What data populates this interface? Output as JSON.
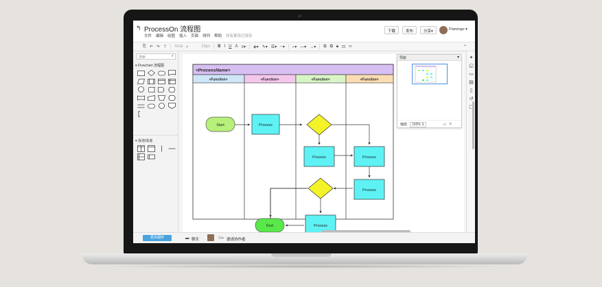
{
  "app": {
    "title": "ProcessOn 流程图",
    "menus": [
      "文件",
      "编辑",
      "绘图",
      "插入",
      "页面",
      "排列",
      "帮助"
    ],
    "save_status": "所有更改已保存",
    "buttons": {
      "download": "下载",
      "publish": "发布",
      "share": "分享▾"
    },
    "user": "Flamingo ▾"
  },
  "toolbar": {
    "font": "Arial",
    "font_size": "16px",
    "bold": "B",
    "italic": "I",
    "underline": "U",
    "text_a": "A"
  },
  "sidebar": {
    "search_placeholder": "搜索",
    "section1": "Flowchart 流程图",
    "section2": "泳池/泳道",
    "more_button": "更多图形"
  },
  "navigator": {
    "title": "导航",
    "zoom_label": "缩放",
    "zoom_value": "100%"
  },
  "bottombar": {
    "chat": "聊天",
    "invite": "邀请协作者"
  },
  "diagram": {
    "process_name": "<ProcessName>",
    "function_label": "<Function>",
    "lane_colors": [
      "#cfe6f8",
      "#f4c7ec",
      "#d8f5c6",
      "#fadcb4"
    ],
    "start": "Start",
    "end": "End",
    "process": "Process",
    "colors": {
      "start": "#b7f07a",
      "end": "#59e84a",
      "process": "#5ef2f5",
      "decision": "#f3f328",
      "header": "#d7bff2"
    }
  }
}
